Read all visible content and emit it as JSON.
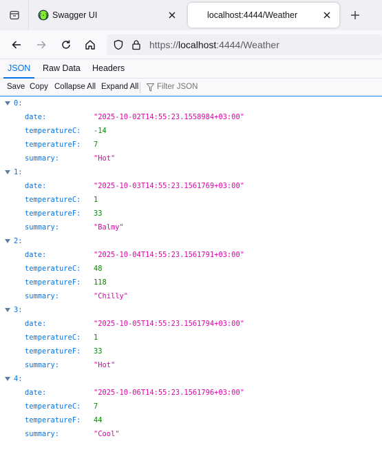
{
  "tabs": [
    {
      "title": "Swagger UI"
    },
    {
      "title": "localhost:4444/Weather"
    }
  ],
  "url": {
    "scheme": "https://",
    "host": "localhost",
    "rest": ":4444/Weather"
  },
  "viewer_tabs": [
    "JSON",
    "Raw Data",
    "Headers"
  ],
  "toolbar": {
    "save": "Save",
    "copy": "Copy",
    "collapse_all": "Collapse All",
    "expand_all": "Expand All",
    "filter_placeholder": "Filter JSON"
  },
  "keys": {
    "date": "date:",
    "temperatureC": "temperatureC:",
    "temperatureF": "temperatureF:",
    "summary": "summary:"
  },
  "items": [
    {
      "index": "0:",
      "date": "\"2025-10-02T14:55:23.1558984+03:00\"",
      "temperatureC": "-14",
      "temperatureF": "7",
      "summary": "\"Hot\""
    },
    {
      "index": "1:",
      "date": "\"2025-10-03T14:55:23.1561769+03:00\"",
      "temperatureC": "1",
      "temperatureF": "33",
      "summary": "\"Balmy\""
    },
    {
      "index": "2:",
      "date": "\"2025-10-04T14:55:23.1561791+03:00\"",
      "temperatureC": "48",
      "temperatureF": "118",
      "summary": "\"Chilly\""
    },
    {
      "index": "3:",
      "date": "\"2025-10-05T14:55:23.1561794+03:00\"",
      "temperatureC": "1",
      "temperatureF": "33",
      "summary": "\"Hot\""
    },
    {
      "index": "4:",
      "date": "\"2025-10-06T14:55:23.1561796+03:00\"",
      "temperatureC": "7",
      "temperatureF": "44",
      "summary": "\"Cool\""
    }
  ],
  "colors": {
    "key": "#0074e8",
    "string": "#dd00a9",
    "number": "#058b00",
    "accent": "#0074e8",
    "swagger_green": "#85ea2d"
  },
  "icons": [
    "tab-list-icon",
    "swagger-favicon",
    "close-icon",
    "plus-icon",
    "back-arrow-icon",
    "forward-arrow-icon",
    "reload-icon",
    "home-icon",
    "shield-icon",
    "lock-icon",
    "filter-icon",
    "triangle-down-icon"
  ]
}
